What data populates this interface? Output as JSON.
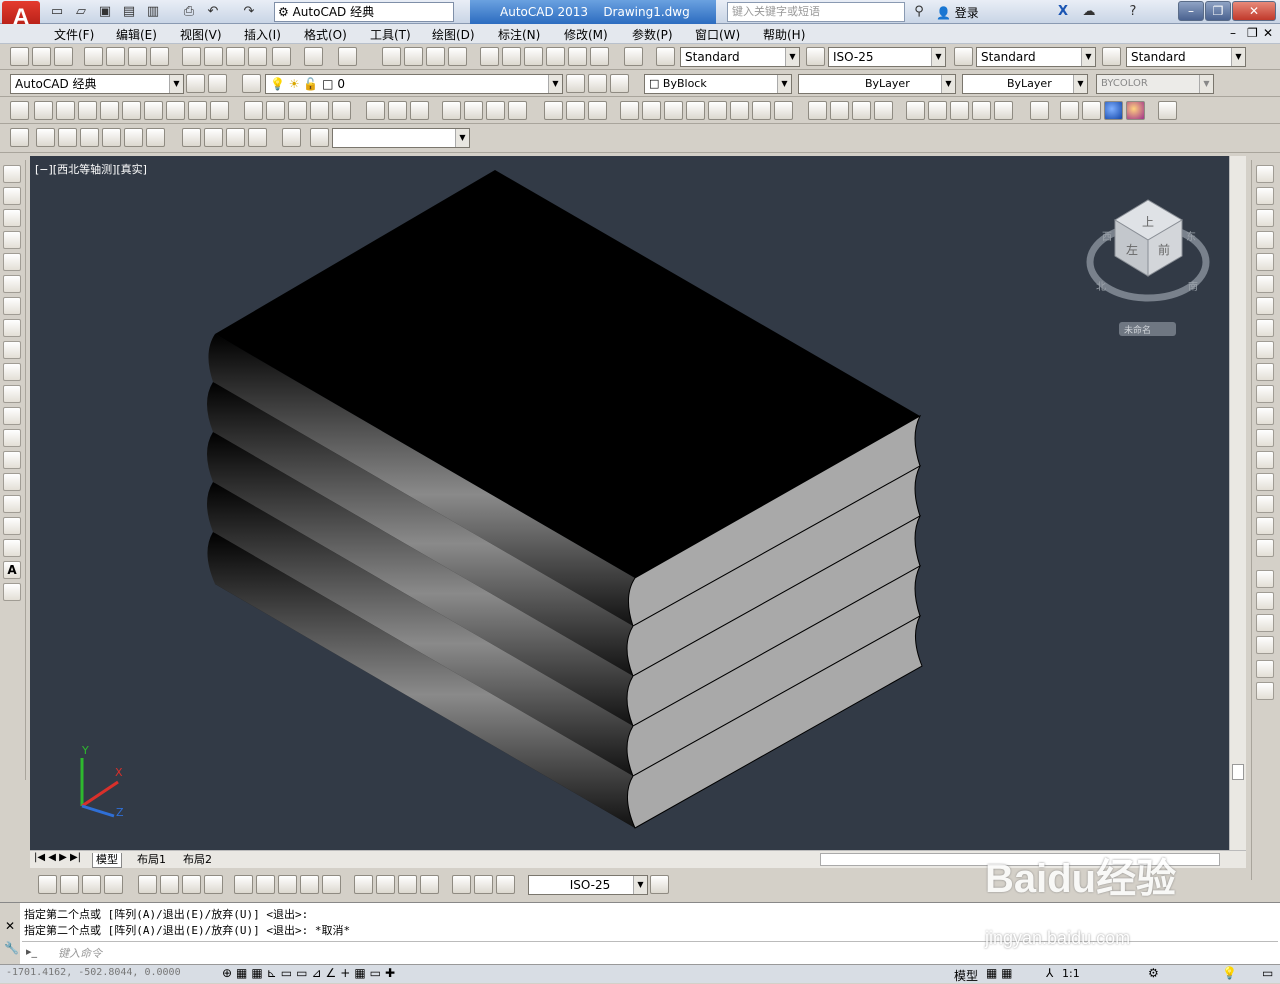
{
  "titlebar": {
    "app_logo": "A",
    "workspace": "AutoCAD 经典",
    "app_name": "AutoCAD 2013",
    "document": "Drawing1.dwg",
    "search_placeholder": "键入关键字或短语",
    "login": "登录"
  },
  "menu": [
    "文件(F)",
    "编辑(E)",
    "视图(V)",
    "插入(I)",
    "格式(O)",
    "工具(T)",
    "绘图(D)",
    "标注(N)",
    "修改(M)",
    "参数(P)",
    "窗口(W)",
    "帮助(H)"
  ],
  "styles": {
    "text_style": "Standard",
    "dim_style": "ISO-25",
    "table_style": "Standard",
    "multileader_style": "Standard"
  },
  "layers": {
    "workspace_combo": "AutoCAD 经典",
    "current_layer": "0",
    "color": "ByBlock",
    "linetype": "ByLayer",
    "lineweight": "ByLayer",
    "plotstyle": "BYCOLOR"
  },
  "viewport": {
    "label": "[−][西北等轴测][真实]",
    "background": "#323a46",
    "viewcube": {
      "faces": [
        "上",
        "左",
        "前"
      ],
      "compass": [
        "北",
        "西",
        "东",
        "南"
      ],
      "ucs_menu": "未命名"
    },
    "ucs": {
      "x": "X",
      "y": "Y",
      "z": "Z"
    }
  },
  "tabs": [
    "模型",
    "布局1",
    "布局2"
  ],
  "dim_toolbar": {
    "dim_style": "ISO-25"
  },
  "command": {
    "history": [
      "指定第二个点或 [阵列(A)/退出(E)/放弃(U)] <退出>:",
      "指定第二个点或 [阵列(A)/退出(E)/放弃(U)] <退出>: *取消*"
    ],
    "prompt_placeholder": "键入命令"
  },
  "status": {
    "coords": "-1701.4162, -502.8044, 0.0000",
    "model_label": "模型",
    "scale": "1:1"
  },
  "watermark": {
    "brand": "Baidu经验",
    "url": "jingyan.baidu.com"
  }
}
